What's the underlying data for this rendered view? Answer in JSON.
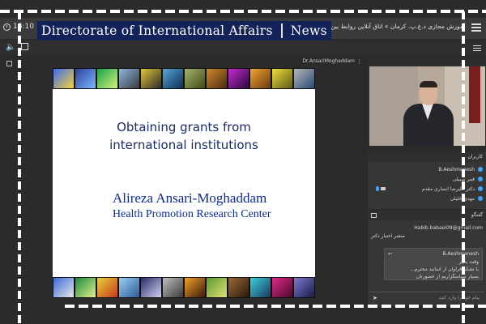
{
  "header": {
    "timer": "16:10",
    "banner_left": "Directorate of International Affairs",
    "banner_right": "News",
    "room_title": "آموزش مجازی د.ع.پ. کرمان » اتاق آنلاین روابط بین الملل"
  },
  "presenter": {
    "name": "Dr.AnsariMoghaddam"
  },
  "slide": {
    "title_line1": "Obtaining grants from",
    "title_line2": "international institutions",
    "author": "Alireza Ansari-Moghaddam",
    "organization": "Health Promotion Research Center"
  },
  "users": {
    "title": "کاربران",
    "list": [
      {
        "name": "B.Aeshmanesh"
      },
      {
        "name": "قمر صبیلی"
      },
      {
        "name": "دکتر علیرضا انصاری مقدم"
      },
      {
        "name": "مهدی خلیلی"
      }
    ]
  },
  "chat": {
    "title": "گفتگو",
    "line1": "Habib.babaei09@gmail.com",
    "line2": "منشر اختیار دکتر",
    "card_name": "B.Aeshmanesh",
    "card_line1": "وقت بخیر",
    "card_line2": "با تشکر فراوان از اساتید محترم...",
    "card_line3": "بسیار سپاسگزاریم از حضورتان",
    "input_placeholder": "پیام خود را وارد کنید"
  },
  "colors": {
    "banner_bg": "#13235a",
    "slide_title": "#1b2a6b",
    "slide_author": "#0a2a9c",
    "accent": "#3ea4ff"
  }
}
